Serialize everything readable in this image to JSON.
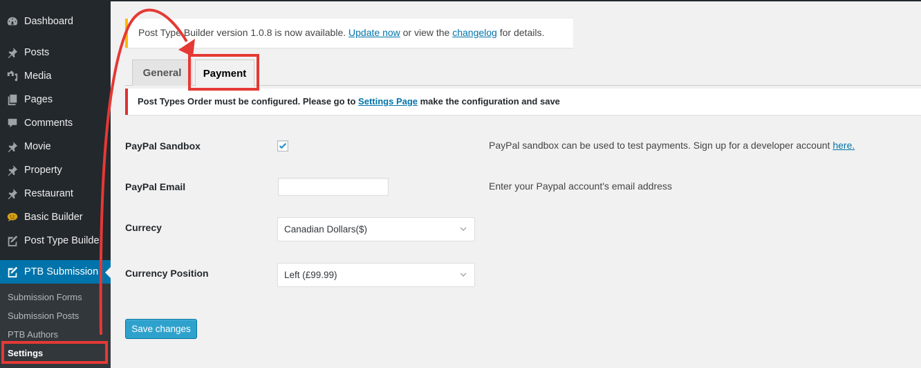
{
  "sidebar": {
    "items": [
      {
        "label": "Dashboard",
        "icon": "dashboard-icon"
      },
      {
        "label": "Posts",
        "icon": "pin-icon"
      },
      {
        "label": "Media",
        "icon": "media-icon"
      },
      {
        "label": "Pages",
        "icon": "pages-icon"
      },
      {
        "label": "Comments",
        "icon": "comment-icon"
      },
      {
        "label": "Movie",
        "icon": "pin-icon"
      },
      {
        "label": "Property",
        "icon": "pin-icon"
      },
      {
        "label": "Restaurant",
        "icon": "pin-icon"
      },
      {
        "label": "Basic Builder",
        "icon": "chat-bubble-icon"
      },
      {
        "label": "Post Type Builder",
        "icon": "edit-icon"
      },
      {
        "label": "PTB Submission",
        "icon": "edit-icon",
        "active": true
      }
    ],
    "submenu": [
      {
        "label": "Submission Forms"
      },
      {
        "label": "Submission Posts"
      },
      {
        "label": "PTB Authors"
      },
      {
        "label": "Settings",
        "current": true
      }
    ]
  },
  "update_notice": {
    "text_before": "Post Type Builder version 1.0.8 is now available. ",
    "update_link": "Update now",
    "text_middle": " or view the ",
    "changelog_link": "changelog",
    "text_after": " for details."
  },
  "tabs": [
    {
      "label": "General",
      "active": false
    },
    {
      "label": "Payment",
      "active": true
    }
  ],
  "error_notice": {
    "text_before": "Post Types Order must be configured. Please go to ",
    "link": "Settings Page",
    "text_after": " make the configuration and save"
  },
  "form": {
    "sandbox": {
      "label": "PayPal Sandbox",
      "checked": true,
      "desc_before": "PayPal sandbox can be used to test payments. Sign up for a developer account ",
      "desc_link": "here."
    },
    "email": {
      "label": "PayPal Email",
      "value": "",
      "desc": "Enter your Paypal account's email address"
    },
    "currency": {
      "label": "Currecy",
      "selected": "Canadian Dollars($)"
    },
    "currency_position": {
      "label": "Currency Position",
      "selected": "Left (£99.99)"
    },
    "save_label": "Save changes"
  },
  "colors": {
    "sidebar_bg": "#23282d",
    "submenu_bg": "#32373c",
    "active_menu": "#0073aa",
    "primary_button": "#2ea2cc",
    "error_border": "#dc3232",
    "update_border": "#ffb900",
    "annotation": "#e53935"
  }
}
